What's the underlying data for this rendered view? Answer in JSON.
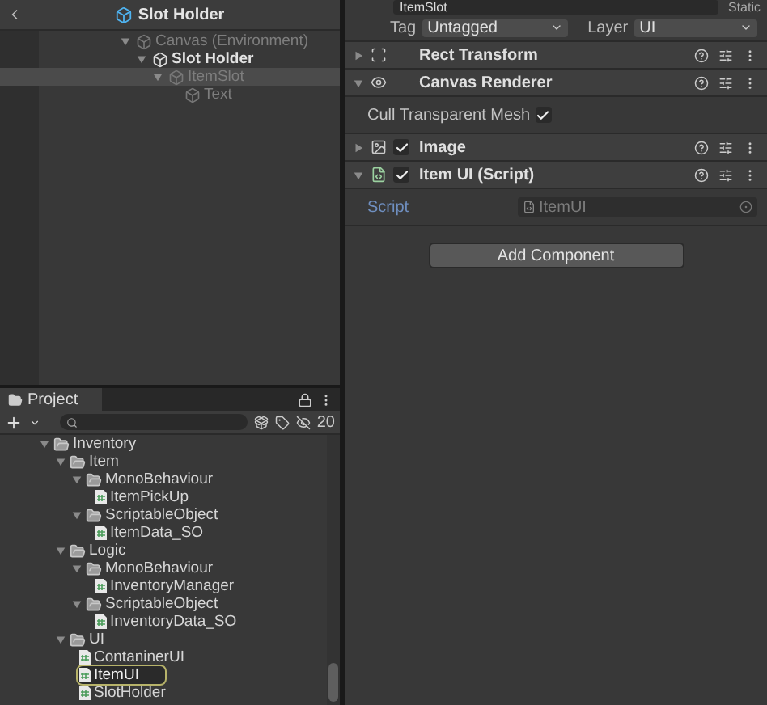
{
  "hierarchy": {
    "title": "Slot Holder",
    "tree": [
      {
        "label": "Canvas (Environment)",
        "dimmed": true,
        "selected": false,
        "expanded": true,
        "children": [
          {
            "label": "Slot Holder",
            "dimmed": false,
            "selected": false,
            "expanded": true,
            "children": [
              {
                "label": "ItemSlot",
                "dimmed": true,
                "selected": true,
                "expanded": true,
                "children": [
                  {
                    "label": "Text",
                    "dimmed": true,
                    "selected": false
                  }
                ]
              }
            ]
          }
        ]
      }
    ]
  },
  "inspector": {
    "name": "ItemSlot",
    "static_label": "Static",
    "tag_label": "Tag",
    "tag_value": "Untagged",
    "layer_label": "Layer",
    "layer_value": "UI",
    "components": [
      {
        "title": "Rect Transform",
        "kind": "rect",
        "expanded": false
      },
      {
        "title": "Canvas Renderer",
        "kind": "renderer",
        "expanded": true,
        "properties": [
          {
            "label": "Cull Transparent Mesh",
            "kind": "toggle",
            "checked": true
          }
        ]
      },
      {
        "title": "Image",
        "kind": "image",
        "expanded": false,
        "enabled": true
      },
      {
        "title": "Item UI (Script)",
        "kind": "script",
        "expanded": true,
        "enabled": true,
        "properties": [
          {
            "label": "Script",
            "kind": "object",
            "value": "ItemUI"
          }
        ]
      }
    ],
    "add_button": "Add Component"
  },
  "project": {
    "tab": "Project",
    "hidden_count": "20",
    "tree": [
      {
        "label": "Inventory",
        "kind": "folder",
        "expanded": true,
        "children": [
          {
            "label": "Item",
            "kind": "folder",
            "expanded": true,
            "children": [
              {
                "label": "MonoBehaviour",
                "kind": "folder",
                "expanded": true,
                "children": [
                  {
                    "label": "ItemPickUp",
                    "kind": "script",
                    "highlighted": false
                  }
                ]
              },
              {
                "label": "ScriptableObject",
                "kind": "folder",
                "expanded": true,
                "children": [
                  {
                    "label": "ItemData_SO",
                    "kind": "script",
                    "highlighted": false
                  }
                ]
              }
            ]
          },
          {
            "label": "Logic",
            "kind": "folder",
            "expanded": true,
            "children": [
              {
                "label": "MonoBehaviour",
                "kind": "folder",
                "expanded": true,
                "children": [
                  {
                    "label": "InventoryManager",
                    "kind": "script",
                    "highlighted": false
                  }
                ]
              },
              {
                "label": "ScriptableObject",
                "kind": "folder",
                "expanded": true,
                "children": [
                  {
                    "label": "InventoryData_SO",
                    "kind": "script",
                    "highlighted": false
                  }
                ]
              }
            ]
          },
          {
            "label": "UI",
            "kind": "folder",
            "expanded": true,
            "children": [
              {
                "label": "ContaninerUI",
                "kind": "script",
                "highlighted": false
              },
              {
                "label": "ItemUI",
                "kind": "script",
                "highlighted": true
              },
              {
                "label": "SlotHolder",
                "kind": "script",
                "highlighted": false
              }
            ]
          }
        ]
      }
    ]
  }
}
